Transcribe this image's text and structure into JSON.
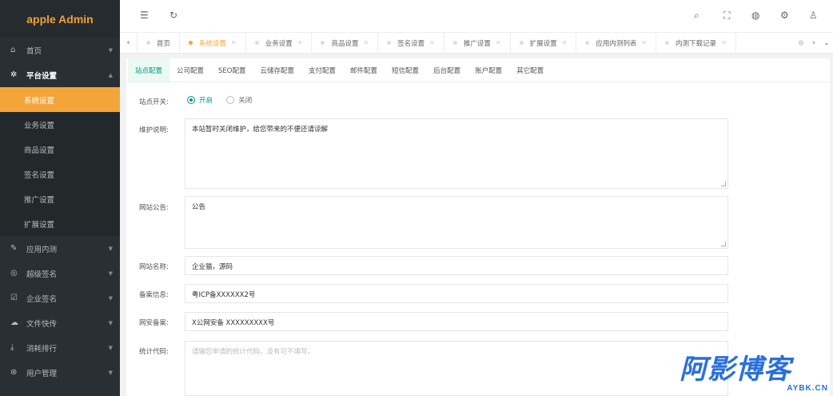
{
  "app": {
    "title": "apple Admin"
  },
  "sidebar": {
    "items": [
      {
        "label": "首页",
        "icon": "home-icon"
      },
      {
        "label": "平台设置",
        "icon": "gear-icon"
      },
      {
        "label": "应用内测",
        "icon": "pen-icon"
      },
      {
        "label": "超级签名",
        "icon": "signature-circle-icon"
      },
      {
        "label": "企业签名",
        "icon": "edit-box-icon"
      },
      {
        "label": "文件快传",
        "icon": "cloud-icon"
      },
      {
        "label": "消耗排行",
        "icon": "download-icon"
      },
      {
        "label": "用户管理",
        "icon": "user-circle-icon"
      }
    ],
    "sub_items": [
      "系统设置",
      "业务设置",
      "商品设置",
      "签名设置",
      "推广设置",
      "扩展设置"
    ]
  },
  "tabs": [
    {
      "label": "首页"
    },
    {
      "label": "系统设置",
      "active": true
    },
    {
      "label": "业务设置"
    },
    {
      "label": "商品设置"
    },
    {
      "label": "签名设置"
    },
    {
      "label": "推广设置"
    },
    {
      "label": "扩展设置"
    },
    {
      "label": "应用内测列表"
    },
    {
      "label": "内测下载记录"
    }
  ],
  "config_tabs": [
    "站点配置",
    "公司配置",
    "SEO配置",
    "云储存配置",
    "支付配置",
    "邮件配置",
    "短信配置",
    "后台配置",
    "账户配置",
    "其它配置"
  ],
  "form": {
    "site_switch": {
      "label": "站点开关:",
      "on": "开启",
      "off": "关闭",
      "value": "开启"
    },
    "maintenance": {
      "label": "维护说明:",
      "value": "本站暂时关闭维护，给您带来的不便还请谅解"
    },
    "notice": {
      "label": "网站公告:",
      "value": "公告"
    },
    "site_name": {
      "label": "网站名称:",
      "value": "企业猫，源码"
    },
    "icp": {
      "label": "备案信息:",
      "value": "粤ICP备XXXXXX2号"
    },
    "police": {
      "label": "网安备案:",
      "value": "X公网安备 XXXXXXXXX号"
    },
    "stats": {
      "label": "统计代码:",
      "placeholder": "请输您申请的统计代码，没有可不填写。"
    }
  },
  "watermark": {
    "big": "阿影博客",
    "small": "AYBK.CN"
  },
  "colors": {
    "accent": "#f4a53a",
    "primary": "#009688",
    "sidebar": "#2a2f33",
    "watermark": "#2a6fdb"
  }
}
